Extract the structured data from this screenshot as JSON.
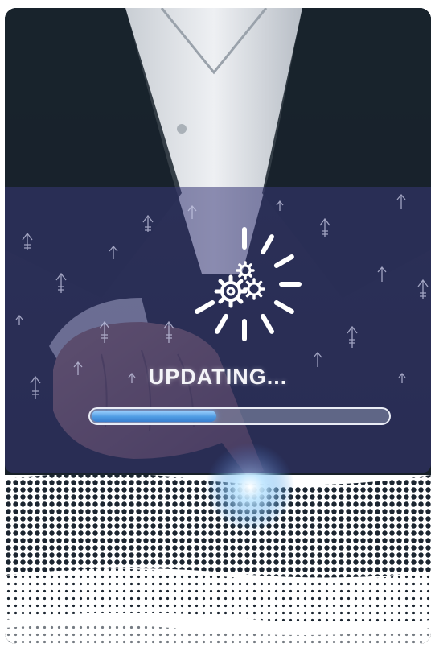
{
  "status": {
    "label": "UPDATING...",
    "progress_fraction": 0.42
  },
  "icons": {
    "spinner": "loading-spinner-icon",
    "gears": "gears-icon",
    "arrows": "upload-arrow-icon"
  },
  "colors": {
    "panel": "#38387a",
    "progress_fill": "#4f9ce3",
    "text": "#f4f4f8",
    "glow": "#bfe6ff"
  }
}
